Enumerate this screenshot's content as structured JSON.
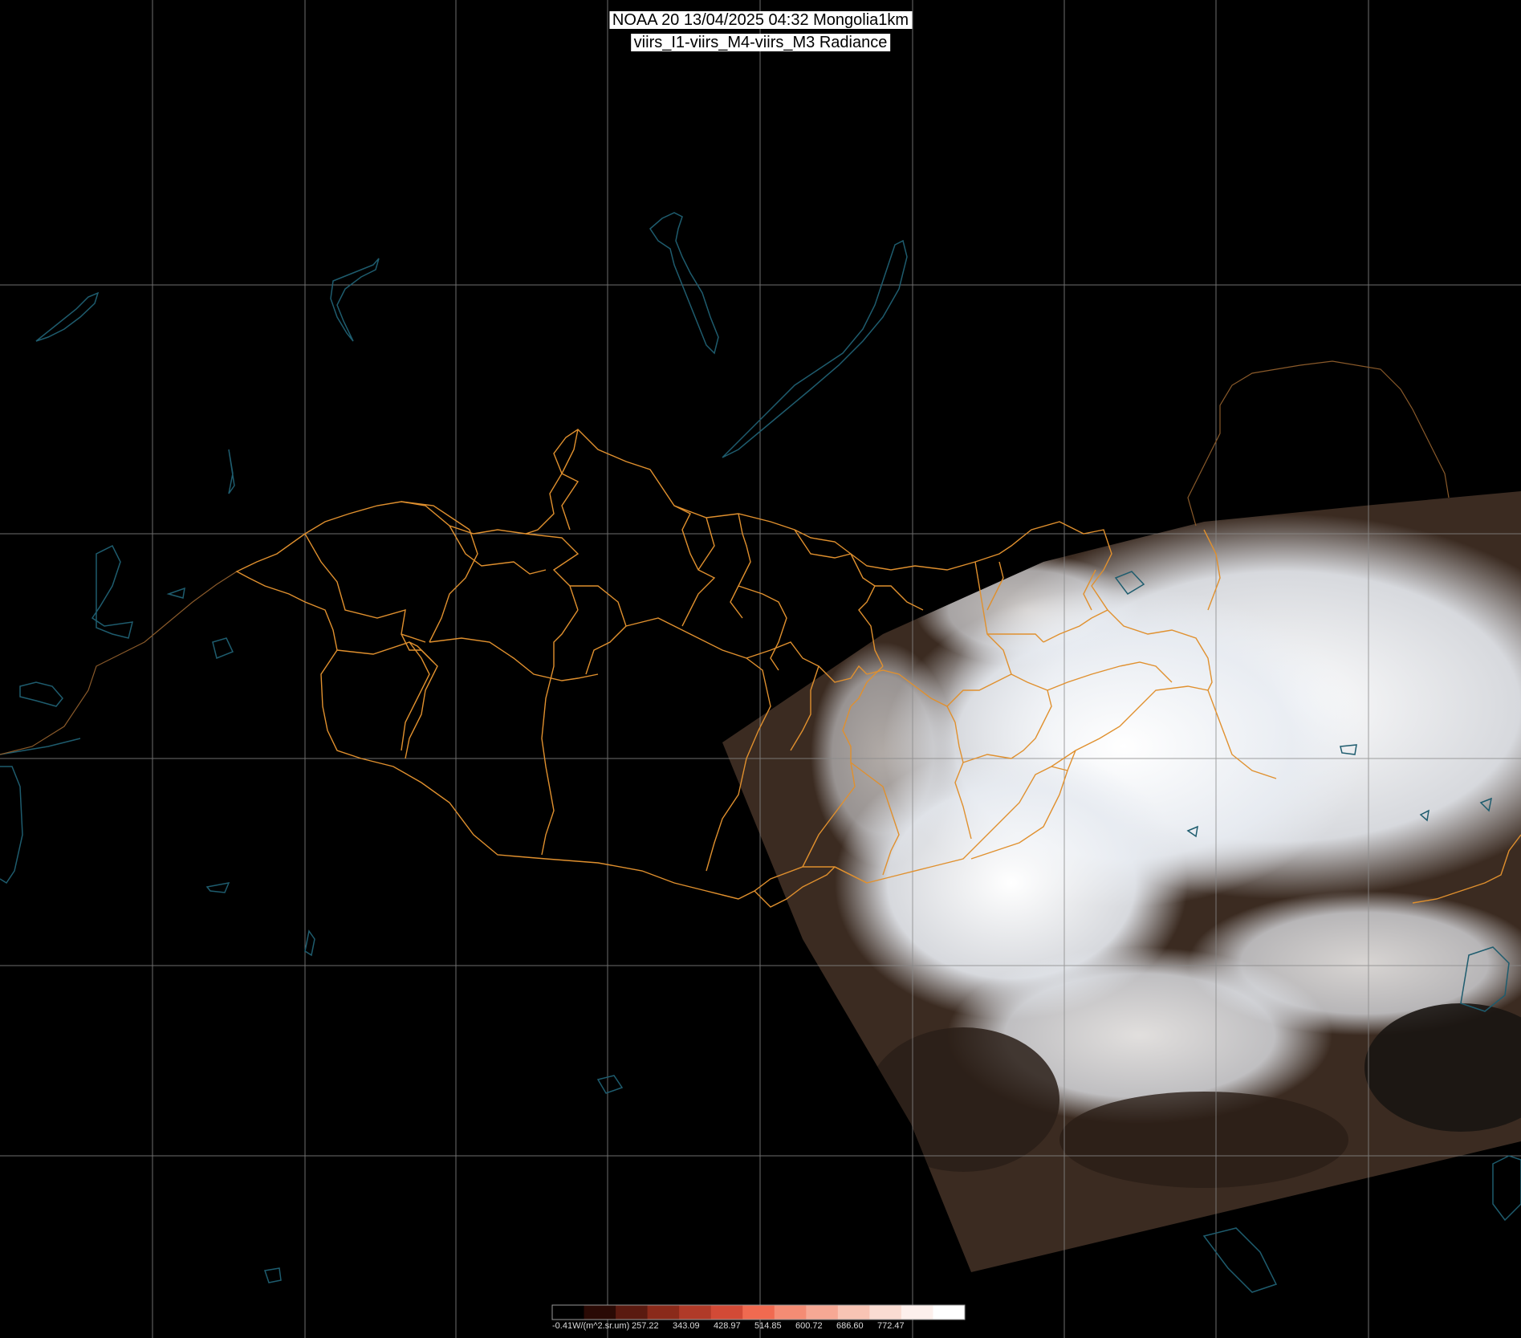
{
  "title": {
    "line1": "NOAA 20 13/04/2025 04:32 Mongolia1km",
    "line2": "viirs_I1-viirs_M4-viirs_M3 Radiance"
  },
  "colorbar": {
    "labels": [
      "-0.41W/(m^2.sr.um)",
      "257.22",
      "343.09",
      "428.97",
      "514.85",
      "600.72",
      "686.60",
      "772.47"
    ],
    "colors": [
      "#000000",
      "#2a0a05",
      "#5a1a10",
      "#8a2a1a",
      "#b03a28",
      "#d24a36",
      "#f06a50",
      "#f48c74",
      "#f6a894",
      "#f8c4b4",
      "#fadcd2",
      "#fdf0ec",
      "#ffffff"
    ]
  },
  "colors": {
    "background": "#000000",
    "graticule": "#8a8a8a",
    "province_borders": "#e0902e",
    "water_outlines": "#1e5c6e",
    "cloud": "#f2f4f8",
    "ground": "#3a2a20"
  }
}
